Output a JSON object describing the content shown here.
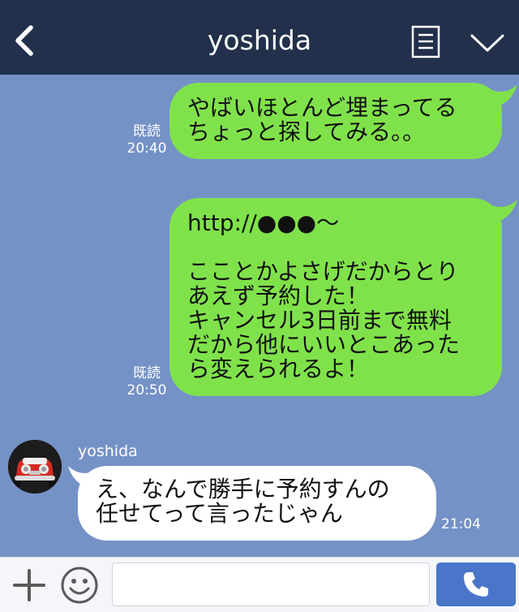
{
  "header": {
    "title": "yoshida",
    "back_icon": "chevron-left-icon",
    "memo_icon": "note-icon",
    "menu_icon": "chevron-down-icon",
    "background": "#22304b"
  },
  "chat": {
    "background": "#7592c6",
    "messages": [
      {
        "side": "sent",
        "text": "やばいほとんど埋まってる\nちょっと探してみる。。",
        "read": "既読",
        "time": "20:40"
      },
      {
        "side": "sent",
        "text": "http://●●●〜\n\nこことかよさげだからとり\nあえず予約した！\nキャンセル3日前まで無料\nだから他にいいとこあった\nら変えられるよ！",
        "read": "既読",
        "time": "20:50"
      },
      {
        "side": "received",
        "sender": "yoshida",
        "text": "え、なんで勝手に予約すんの\n任せてって言ったじゃん",
        "time": "21:04"
      }
    ],
    "sent_bubble_color": "#80e24b",
    "received_bubble_color": "#ffffff"
  },
  "footer": {
    "input_value": "",
    "input_placeholder": "",
    "plus_icon": "plus-icon",
    "sticker_icon": "smile-icon",
    "call_icon": "phone-icon",
    "call_button_color": "#4a76c9"
  }
}
